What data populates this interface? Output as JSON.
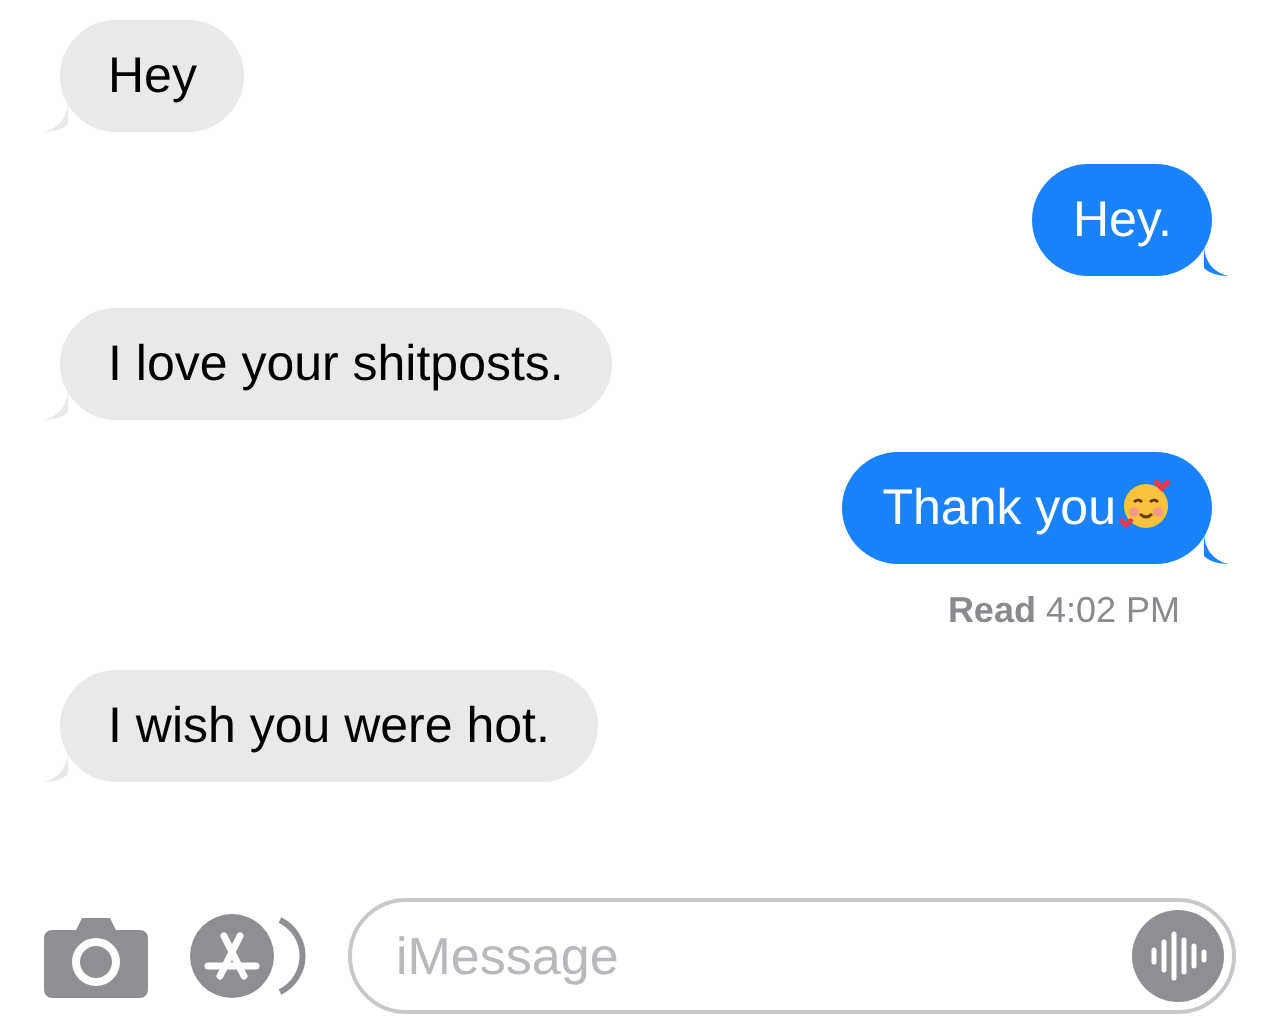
{
  "messages": [
    {
      "kind": "received",
      "text": "Hey"
    },
    {
      "kind": "sent",
      "text": "Hey."
    },
    {
      "kind": "received",
      "text": "I love your shitposts."
    },
    {
      "kind": "sent",
      "text": "Thank you",
      "emoji": true
    },
    {
      "kind": "receipt",
      "text": "**Read** 4:02 PM"
    },
    {
      "kind": "received",
      "text": "I wish you were hot."
    }
  ],
  "composer": {
    "placeholder": "iMessage"
  }
}
